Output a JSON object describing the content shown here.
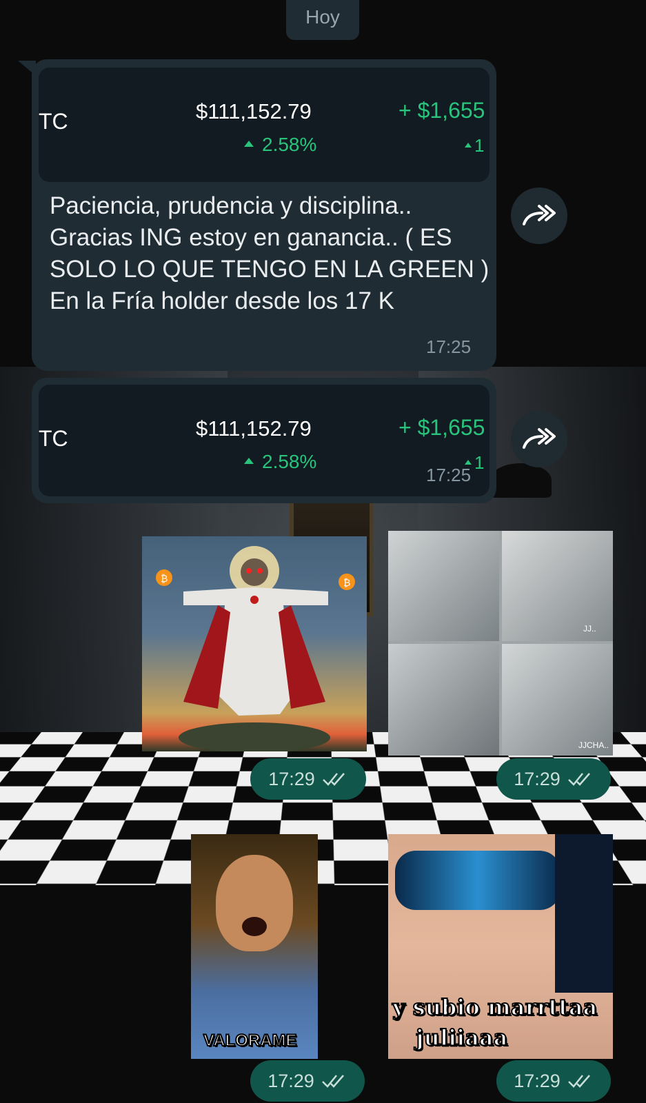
{
  "chat": {
    "date_label": "Hoy"
  },
  "quote_card": {
    "ticker": "TC",
    "price": "$111,152.79",
    "percent": "2.58%",
    "change": "+ $1,655",
    "change_pct": "1"
  },
  "message1": {
    "text": "Paciencia, prudencia y disciplina.. Gracias ING estoy en ganancia.. ( ES SOLO LO QUE TENGO EN LA GREEN ) En la Fría holder desde los 17 K",
    "time": "17:25"
  },
  "message2": {
    "time": "17:25"
  },
  "media_messages": [
    {
      "time": "17:29",
      "content": "jesus-bitcoin-image"
    },
    {
      "time": "17:29",
      "content": "four-panel-video"
    },
    {
      "time": "17:29",
      "content": "valorame-sticker",
      "caption": "VALORAME"
    },
    {
      "time": "17:29",
      "content": "sunglasses-meme",
      "caption_line1": "y subio marrttaa",
      "caption_line2": "juliiaaa"
    }
  ],
  "video_tags": {
    "tag1": "JJ..",
    "tag2": "JJCHA.."
  },
  "icons": {
    "forward": "forward-arrow-icon",
    "read": "double-check-icon"
  },
  "colors": {
    "bubble_in": "#1f2c33",
    "bubble_out_meta": "#11564a",
    "gain_green": "#29c47c",
    "text_primary": "#e9edef",
    "text_meta": "#8696a0"
  }
}
